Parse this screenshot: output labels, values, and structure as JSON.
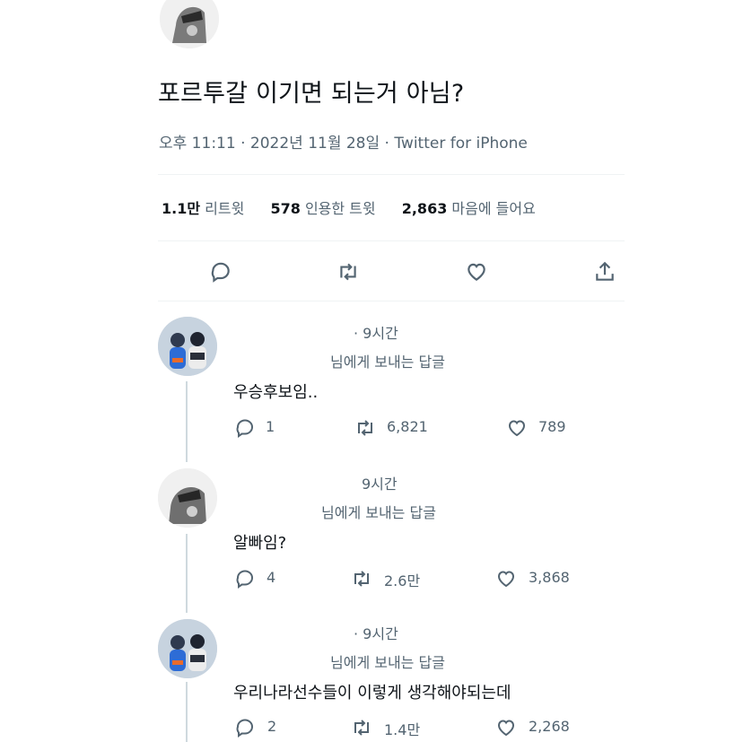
{
  "main_tweet": {
    "text": "포르투갈 이기면 되는거 아님?",
    "meta": "오후 11:11 · 2022년 11월 28일 · Twitter for iPhone",
    "stats": {
      "retweets_value": "1.1만",
      "retweets_label": "리트윗",
      "quotes_value": "578",
      "quotes_label": "인용한 트윗",
      "likes_value": "2,863",
      "likes_label": "마음에 들어요"
    },
    "actions": [
      "reply-icon",
      "retweet-icon",
      "like-icon",
      "share-icon"
    ]
  },
  "replies": [
    {
      "time": "· 9시간",
      "replying_to": "님에게 보내는 답글",
      "text": "우승후보임..",
      "counts": {
        "reply": "1",
        "retweet": "6,821",
        "like": "789"
      }
    },
    {
      "time": "9시간",
      "replying_to": "님에게 보내는 답글",
      "text": "알빠임?",
      "counts": {
        "reply": "4",
        "retweet": "2.6만",
        "like": "3,868"
      }
    },
    {
      "time": "· 9시간",
      "replying_to": "님에게 보내는 답글",
      "text": "우리나라선수들이 이렇게 생각해야되는데",
      "counts": {
        "reply": "2",
        "retweet": "1.4만",
        "like": "2,268"
      }
    }
  ],
  "colors": {
    "text": "#0f1419",
    "muted": "#536471",
    "divider": "#eff3f4"
  }
}
